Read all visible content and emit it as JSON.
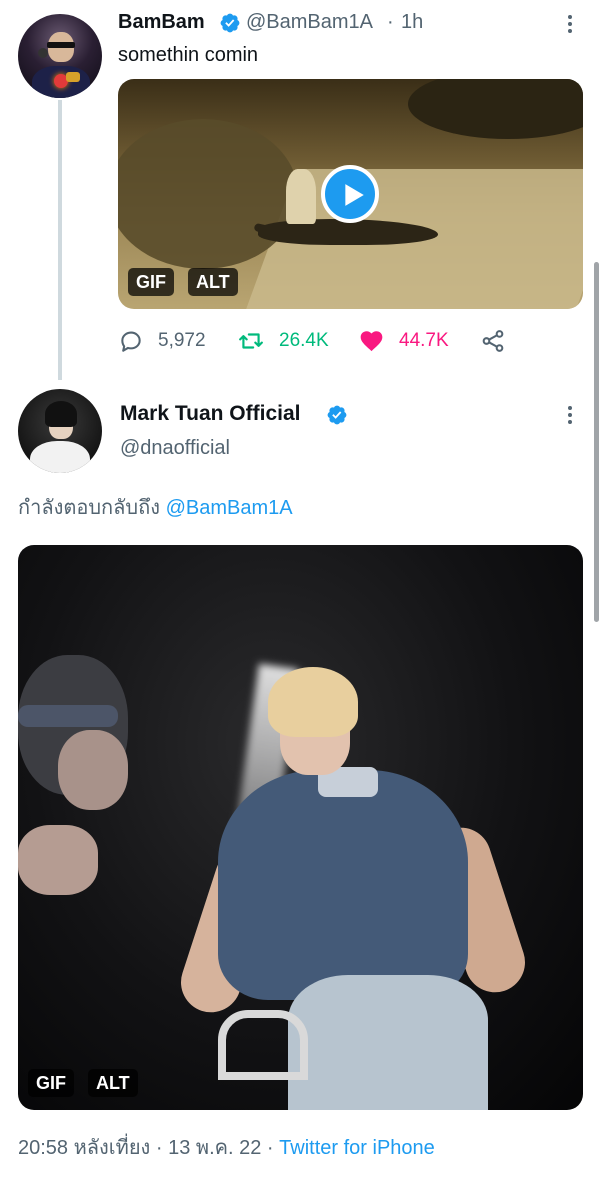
{
  "tweet1": {
    "display_name": "BamBam",
    "verified_icon": "verified-badge-icon",
    "handle": "@BamBam1A",
    "separator": "·",
    "time": "1h",
    "text": "somethin comin",
    "media": {
      "badges": {
        "gif": "GIF",
        "alt": "ALT"
      },
      "play_icon": "play-icon"
    },
    "actions": {
      "reply_count": "5,972",
      "retweet_count": "26.4K",
      "like_count": "44.7K"
    }
  },
  "tweet2": {
    "display_name": "Mark Tuan Official",
    "verified_icon": "verified-badge-icon",
    "handle": "@dnaofficial",
    "reply_prefix": "กำลังตอบกลับถึง",
    "reply_mention": "@BamBam1A",
    "media": {
      "badges": {
        "gif": "GIF",
        "alt": "ALT"
      }
    },
    "timestamp": "20:58 หลังเที่ยง · 13 พ.ค. 22 · ",
    "source": "Twitter for iPhone"
  },
  "colors": {
    "accent": "#1d9bf0",
    "retweet": "#00ba7c",
    "like": "#f91880",
    "muted": "#536471",
    "text": "#0f1419"
  }
}
